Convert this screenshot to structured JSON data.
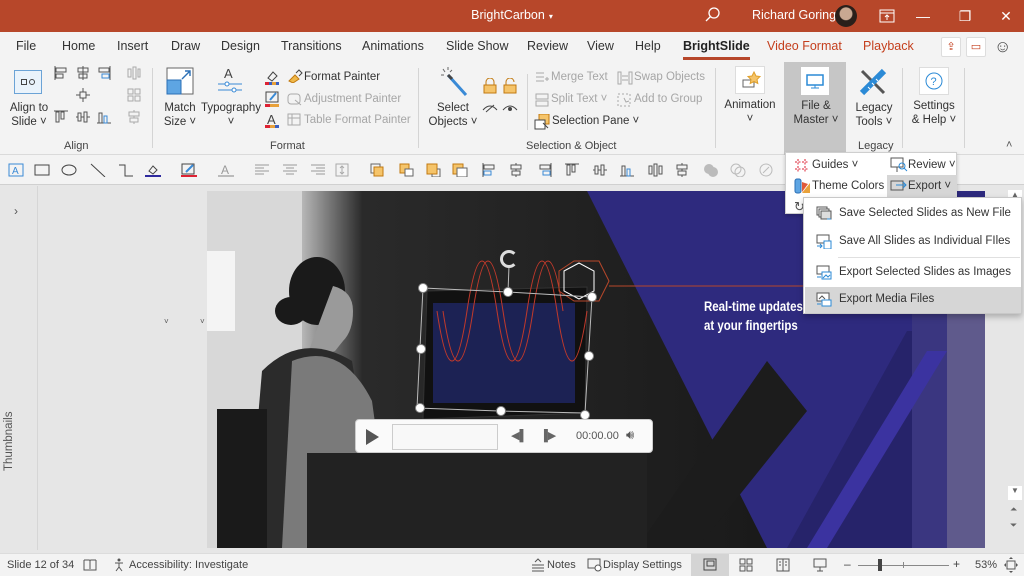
{
  "titlebar": {
    "title": "BrightCarbon",
    "title_caret": "▾",
    "user_name": "Richard Goring",
    "icons": [
      "search-icon",
      "ribbon-display-icon",
      "minimize-icon",
      "restore-icon",
      "close-icon"
    ],
    "minimize": "—",
    "restore": "❐",
    "close": "✕"
  },
  "tabs": [
    {
      "label": "File"
    },
    {
      "label": "Home"
    },
    {
      "label": "Insert"
    },
    {
      "label": "Draw"
    },
    {
      "label": "Design"
    },
    {
      "label": "Transitions"
    },
    {
      "label": "Animations"
    },
    {
      "label": "Slide Show"
    },
    {
      "label": "Review"
    },
    {
      "label": "View"
    },
    {
      "label": "Help"
    },
    {
      "label": "BrightSlide",
      "active": true
    },
    {
      "label": "Video Format",
      "contextual": true
    },
    {
      "label": "Playback",
      "contextual": true
    }
  ],
  "ribbon": {
    "align": {
      "group_label": "Align",
      "align_to_slide": "Align to",
      "align_to_slide_2": "Slide ˅"
    },
    "format": {
      "group_label": "Format",
      "match_size": "Match",
      "match_size_2": "Size ˅",
      "typography": "Typography",
      "typography_caret": "˅",
      "format_painter": "Format Painter",
      "adjustment_painter": "Adjustment Painter",
      "table_format_painter": "Table Format Painter"
    },
    "selection": {
      "group_label": "Selection & Object",
      "select_objects": "Select",
      "select_objects_2": "Objects ˅",
      "merge_text": "Merge Text",
      "swap_objects": "Swap Objects",
      "split_text": "Split Text ˅",
      "add_to_group": "Add to Group",
      "selection_pane": "Selection Pane ˅"
    },
    "animation": {
      "label": "Animation",
      "caret": "˅"
    },
    "legacy": {
      "group_label": "Legacy",
      "file_master": "File &",
      "file_master_2": "Master ˅",
      "legacy_tools": "Legacy",
      "legacy_tools_2": "Tools ˅",
      "settings_help": "Settings",
      "settings_help_2": "& Help ˅"
    },
    "collapse": "˄"
  },
  "file_master_menu": {
    "guides": "Guides ˅",
    "review": "Review ˅",
    "theme_colors": "Theme Colors",
    "export": "Export ˅"
  },
  "export_menu": {
    "items": [
      {
        "label": "Save Selected Slides as New File"
      },
      {
        "label": "Save All Slides as Individual FIles"
      },
      {
        "label": "Export Selected Slides as Images"
      },
      {
        "label": "Export Media Files",
        "highlighted": true
      }
    ]
  },
  "toolbar": {
    "overflow": "»"
  },
  "thumbnails": {
    "label": "Thumbnails",
    "expand": "›"
  },
  "slide": {
    "headline_1": "Real-time updates",
    "headline_2": "at your fingertips",
    "media_time": "00:00.00",
    "colors": {
      "purple": "#2e2a7e",
      "accent_red": "#b7472a"
    }
  },
  "status": {
    "slide_info": "Slide 12 of 34",
    "accessibility": "Accessibility: Investigate",
    "notes": "Notes",
    "display_settings": "Display Settings",
    "zoom_minus": "–",
    "zoom_plus": "+",
    "zoom_level": "53%",
    "zoom_fraction": 0.53
  },
  "colors": {
    "brand": "#b7472a",
    "ribbon_bg": "#f3f3f3"
  }
}
